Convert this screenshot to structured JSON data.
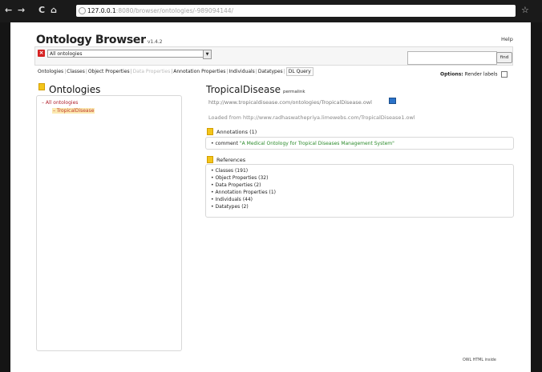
{
  "browser": {
    "address_host": "127.0.0.1",
    "address_rest": ":8080/browser/ontologies/-989094144/"
  },
  "app": {
    "title": "Ontology Browser",
    "version": "v1.4.2",
    "help_label": "Help"
  },
  "ontology_selector": {
    "selected": "All ontologies"
  },
  "search": {
    "value": "",
    "button_label": "find"
  },
  "tabs": [
    {
      "label": "Ontologies",
      "enabled": true
    },
    {
      "label": "Classes",
      "enabled": true
    },
    {
      "label": "Object Properties",
      "enabled": true
    },
    {
      "label": "Data Properties",
      "enabled": false
    },
    {
      "label": "Annotation Properties",
      "enabled": true
    },
    {
      "label": "Individuals",
      "enabled": true
    },
    {
      "label": "Datatypes",
      "enabled": true
    },
    {
      "label": "DL Query",
      "enabled": true
    }
  ],
  "options": {
    "label": "Options:",
    "render_labels": "Render labels"
  },
  "left_panel": {
    "heading": "Ontologies",
    "tree": {
      "root": "All ontologies",
      "child": "TropicalDisease"
    }
  },
  "main": {
    "title": "TropicalDisease",
    "permalink_label": "permalink",
    "ontology_iri": "http://www.tropicaldisease.com/ontologies/TropicalDisease.owl",
    "loaded_from": "Loaded from http://www.radhaswathepriya.limewebs.com/TropicalDisease1.owl",
    "annotations": {
      "heading": "Annotations (1)",
      "property": "comment",
      "value": "\"A Medical Ontology for Tropical Diseases Management System\""
    },
    "references": {
      "heading": "References",
      "items": [
        "Classes (191)",
        "Object Properties (32)",
        "Data Properties (2)",
        "Annotation Properties (1)",
        "Individuals (44)",
        "Datatypes (2)"
      ]
    }
  },
  "footer": {
    "text": "OWL HTML inside"
  },
  "colors": {
    "accent_red": "#d62222",
    "ontology_yellow": "#f3c51b",
    "link_red": "#b01e2a",
    "literal_green": "#2b8b2b"
  }
}
